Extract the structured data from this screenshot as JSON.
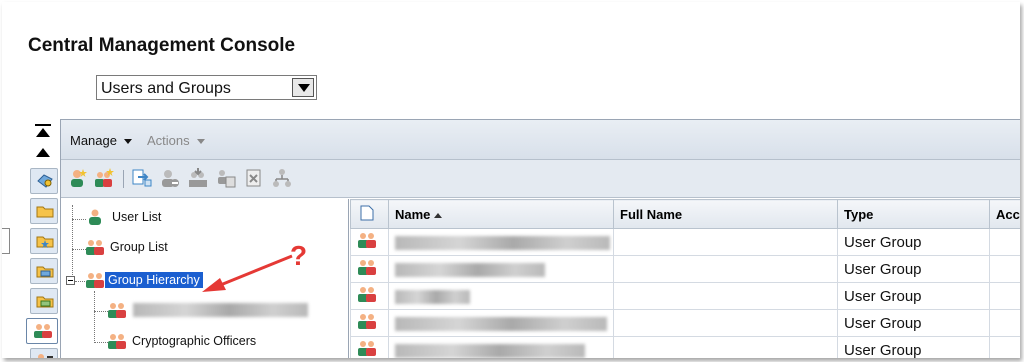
{
  "app": {
    "title": "Central Management Console"
  },
  "area_select": {
    "value": "Users and Groups"
  },
  "menubar": {
    "manage": "Manage",
    "actions": "Actions"
  },
  "tree": {
    "items": [
      {
        "label": "User List"
      },
      {
        "label": "Group List"
      },
      {
        "label": "Group Hierarchy"
      },
      {
        "label": ""
      },
      {
        "label": "Cryptographic Officers"
      }
    ]
  },
  "grid": {
    "columns": [
      "Name",
      "Full Name",
      "Type",
      "Acc"
    ],
    "rows": [
      {
        "type": "User Group"
      },
      {
        "type": "User Group"
      },
      {
        "type": "User Group"
      },
      {
        "type": "User Group"
      },
      {
        "type": "User Group"
      }
    ]
  },
  "annotation": {
    "text": "?",
    "color": "#e53935"
  },
  "colors": {
    "selection": "#1b5fd0",
    "toolbar": "#e4eaf1"
  },
  "icons": [
    "collapse-top-icon",
    "collapse-up-icon",
    "properties-icon",
    "folder-icon",
    "favorites-folder-icon",
    "inbox-folder-icon",
    "inbox-star-icon",
    "users-icon",
    "users-list-icon",
    "new-user-icon",
    "new-group-icon",
    "add-to-group-icon",
    "remove-user-icon",
    "import-icon",
    "copy-icon",
    "delete-icon",
    "hierarchy-icon"
  ]
}
